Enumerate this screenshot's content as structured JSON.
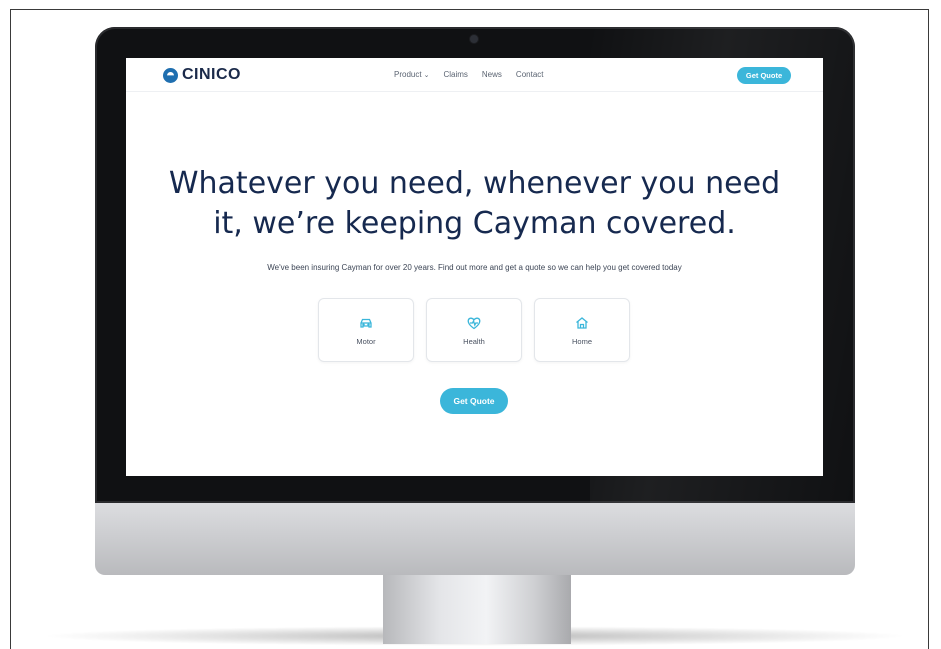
{
  "brand": {
    "name": "CINICO",
    "primary_color": "#1f6fb0",
    "accent_color": "#3bb6da",
    "text_color": "#16294f"
  },
  "nav": {
    "items": [
      {
        "label": "Product",
        "has_dropdown": true
      },
      {
        "label": "Claims"
      },
      {
        "label": "News"
      },
      {
        "label": "Contact"
      }
    ],
    "cta_label": "Get Quote"
  },
  "hero": {
    "title_line1": "Whatever you need, whenever you need",
    "title_line2": "it, we’re keeping Cayman covered.",
    "subtitle": "We've been insuring Cayman for over 20 years. Find out more and get a quote so we can help you get covered today"
  },
  "products": [
    {
      "label": "Motor",
      "icon": "car-icon"
    },
    {
      "label": "Health",
      "icon": "heart-pulse-icon"
    },
    {
      "label": "Home",
      "icon": "house-icon"
    }
  ],
  "cta": {
    "label": "Get Quote"
  }
}
